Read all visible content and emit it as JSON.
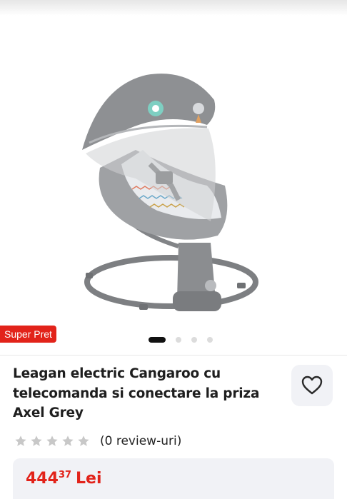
{
  "gallery": {
    "badge": "Super Pret",
    "slide_count": 4,
    "active_slide": 1
  },
  "product": {
    "title": "Leagan electric Cangaroo cu telecomanda si conectare la priza Axel Grey",
    "rating": 0,
    "max_rating": 5,
    "review_label": "(0 review-uri)"
  },
  "price": {
    "integer": "444",
    "cents": "37",
    "currency": "Lei"
  },
  "colors": {
    "accent": "#e2231a",
    "panel": "#f1f2f6",
    "star": "#c8c8c8"
  },
  "icons": {
    "favorite": "heart-outline-icon",
    "rating": "star-icon"
  }
}
